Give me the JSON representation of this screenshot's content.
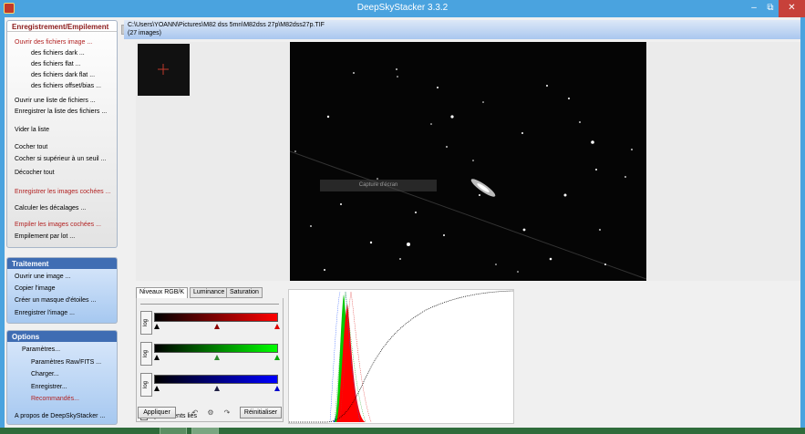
{
  "window": {
    "title": "DeepSkyStacker 3.3.2",
    "controls": {
      "minimize": "–",
      "restore": "⧉",
      "close": "✕"
    }
  },
  "left_panel": {
    "registration": {
      "title": "Enregistrement/Empilement",
      "items": [
        "Ouvrir des fichiers image ...",
        "des fichiers dark ...",
        "des fichiers flat ...",
        "des fichiers dark flat ...",
        "des fichiers offset/bias ...",
        "Ouvrir une liste de fichiers ...",
        "Enregistrer la liste des fichiers ...",
        "Vider la liste",
        "Cocher tout",
        "Cocher si supérieur à un seuil ...",
        "Décocher tout",
        "Enregistrer les images cochées ...",
        "Calculer les décalages ...",
        "Empiler les images cochées ...",
        "Empilement par lot ..."
      ]
    },
    "processing": {
      "title": "Traitement",
      "items": [
        "Ouvrir une image ...",
        "Copier l'image",
        "Créer un masque d'étoiles ...",
        "Enregistrer l'image ..."
      ]
    },
    "options": {
      "title": "Options",
      "items": [
        "Paramètres...",
        "Paramètres Raw/FITS ...",
        "Charger...",
        "Enregistrer...",
        "Recommandés...",
        "A propos de DeepSkyStacker ..."
      ]
    }
  },
  "file_info": {
    "path": "C:\\Users\\YOANN\\Pictures\\M82 dss 5mn\\M82dss 27p\\M82dss27p.TIF",
    "count": "(27 images)"
  },
  "viewer": {
    "overlay_text": "Capture d'écran"
  },
  "levels_panel": {
    "tabs": [
      "Niveaux RGB/K",
      "Luminance",
      "Saturation"
    ],
    "log_label": "log",
    "linked_label": "Ajustements liés",
    "apply_label": "Appliquer",
    "reset_label": "Réinitialiser"
  },
  "colors": {
    "title_bar": "#4aa3df",
    "accent_red": "#b22222",
    "panel_blue": "#3f6db3"
  },
  "icons": [
    "app-icon",
    "minimize-icon",
    "restore-icon",
    "close-icon",
    "undo-icon",
    "settings-icon",
    "redo-icon"
  ]
}
